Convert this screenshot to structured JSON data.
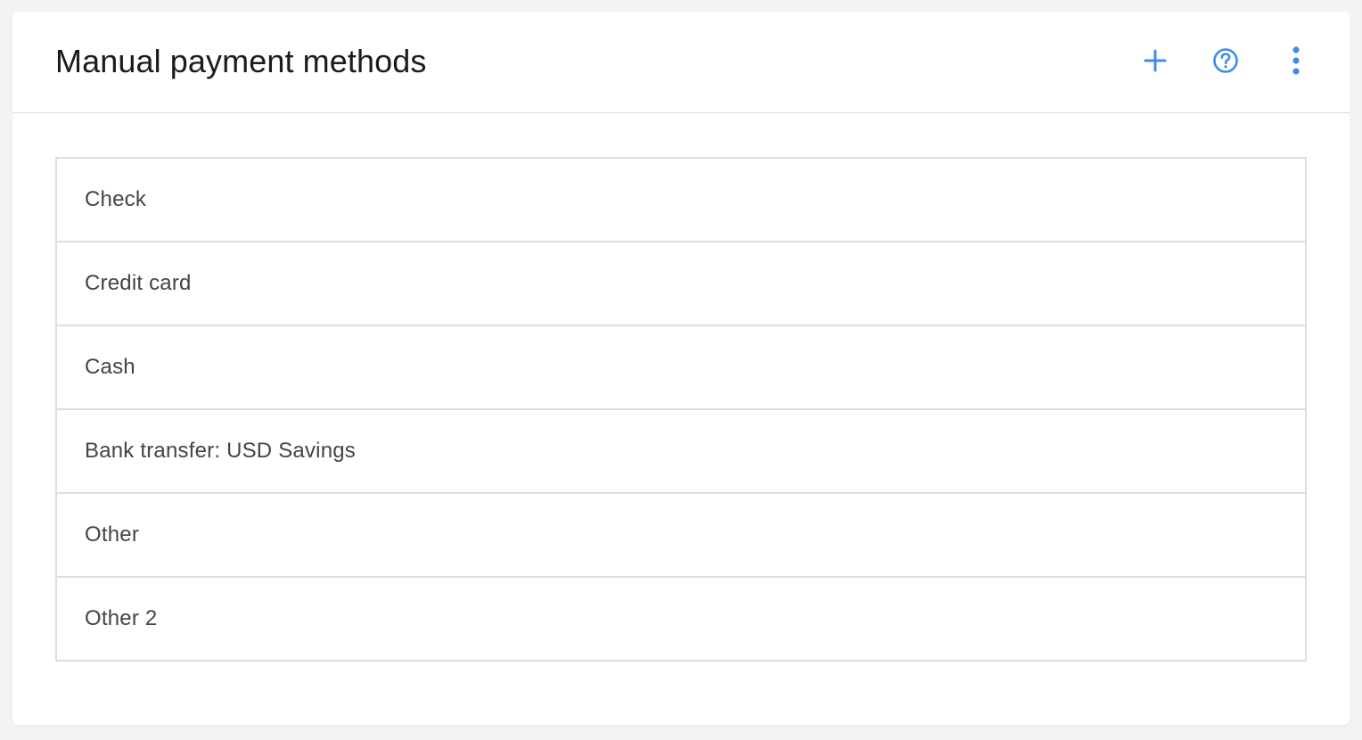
{
  "page": {
    "title": "Manual payment methods"
  },
  "header_actions": [
    {
      "name": "add-button",
      "icon": "plus-icon"
    },
    {
      "name": "help-button",
      "icon": "question-circle-icon"
    },
    {
      "name": "more-options-button",
      "icon": "vertical-dots-icon"
    }
  ],
  "methods": [
    {
      "label": "Check"
    },
    {
      "label": "Credit card"
    },
    {
      "label": "Cash"
    },
    {
      "label": "Bank transfer: USD Savings"
    },
    {
      "label": "Other"
    },
    {
      "label": "Other 2"
    }
  ],
  "colors": {
    "accent": "#3b8ee8",
    "background": "#f3f3f3",
    "card": "#ffffff",
    "border": "#dedede",
    "title_text": "#1b1b1b",
    "row_text": "#444444"
  }
}
